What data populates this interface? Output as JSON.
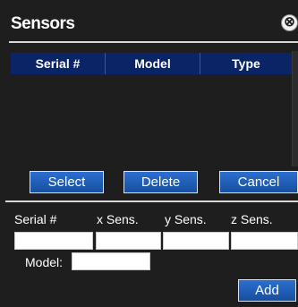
{
  "dialog": {
    "title": "Sensors",
    "close_glyph": "⊗",
    "close_icon": "close-circle-icon"
  },
  "table": {
    "columns": [
      "Serial #",
      "Model",
      "Type"
    ],
    "rows": []
  },
  "actions": {
    "select_label": "Select",
    "delete_label": "Delete",
    "cancel_label": "Cancel"
  },
  "form": {
    "serial_label": "Serial #",
    "x_label": "x Sens.",
    "y_label": "y Sens.",
    "z_label": "z Sens.",
    "model_label": "Model:",
    "serial_value": "",
    "x_value": "",
    "y_value": "",
    "z_value": "",
    "model_value": "",
    "add_label": "Add"
  },
  "colors": {
    "background": "#1e1e1e",
    "header": "#0b2466",
    "button": "#1f5fbf",
    "text": "#ffffff"
  }
}
